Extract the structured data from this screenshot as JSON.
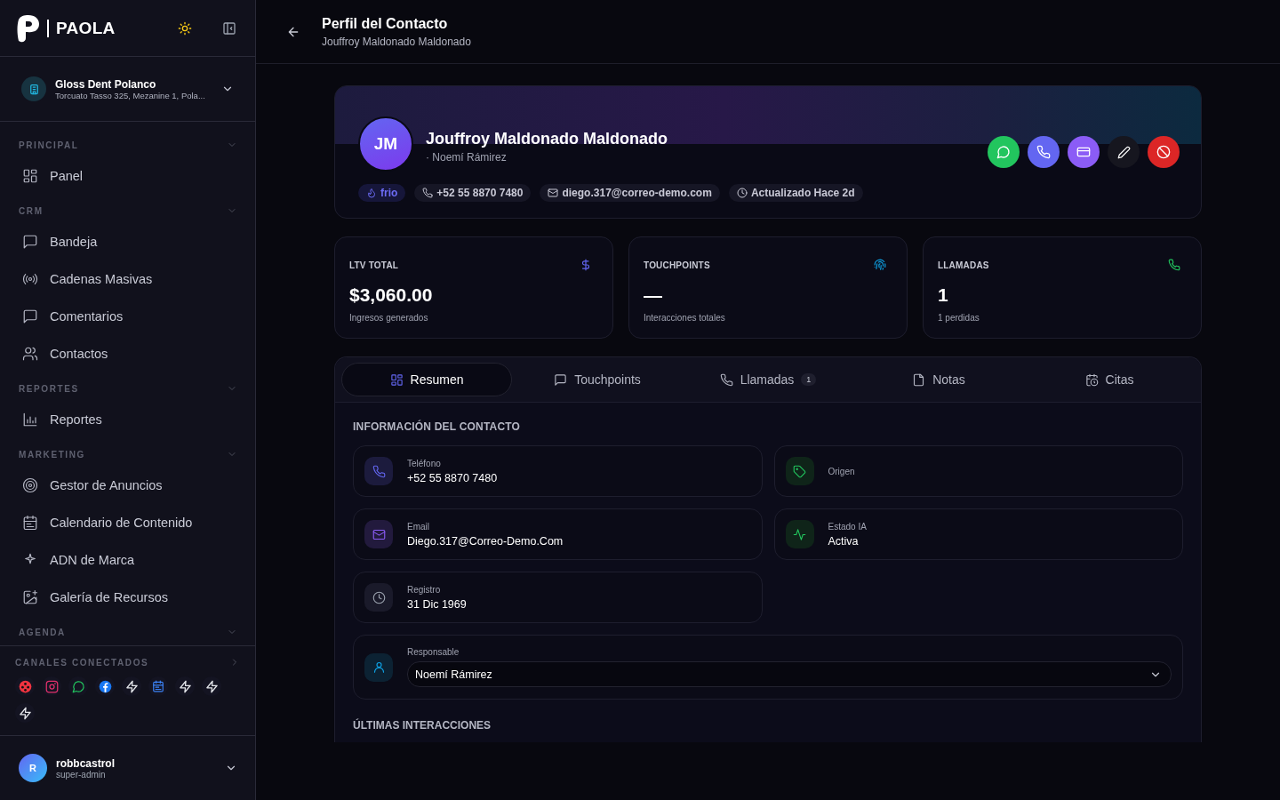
{
  "brand": {
    "name": "PAOLA"
  },
  "clinic": {
    "name": "Gloss Dent Polanco",
    "address": "Torcuato Tasso 325, Mezanine 1, Pola..."
  },
  "sidebar": {
    "sections": [
      {
        "title": "PRINCIPAL",
        "items": [
          {
            "label": "Panel"
          }
        ]
      },
      {
        "title": "CRM",
        "items": [
          {
            "label": "Bandeja"
          },
          {
            "label": "Cadenas Masivas"
          },
          {
            "label": "Comentarios"
          },
          {
            "label": "Contactos"
          }
        ]
      },
      {
        "title": "REPORTES",
        "items": [
          {
            "label": "Reportes"
          }
        ]
      },
      {
        "title": "MARKETING",
        "items": [
          {
            "label": "Gestor de Anuncios"
          },
          {
            "label": "Calendario de Contenido"
          },
          {
            "label": "ADN de Marca"
          },
          {
            "label": "Galería de Recursos"
          }
        ]
      },
      {
        "title": "AGENDA"
      }
    ]
  },
  "channels": {
    "title": "CANALES CONECTADOS"
  },
  "user": {
    "initial": "R",
    "name": "robbcastrol",
    "role": "super-admin"
  },
  "header": {
    "title": "Perfil del Contacto",
    "subtitle": "Jouffroy Maldonado Maldonado"
  },
  "contact": {
    "initials": "JM",
    "name": "Jouffroy Maldonado Maldonado",
    "owner": "· Noemí Rámirez",
    "chips": [
      {
        "kind": "temperature",
        "text": "frio"
      },
      {
        "kind": "phone",
        "text": "+52 55 8870 7480"
      },
      {
        "kind": "email",
        "text": "diego.317@correo-demo.com"
      },
      {
        "kind": "updated",
        "text": "Actualizado Hace 2d"
      }
    ]
  },
  "stats": [
    {
      "label": "LTV TOTAL",
      "value": "$3,060.00",
      "note": "Ingresos generados"
    },
    {
      "label": "TOUCHPOINTS",
      "value": "—",
      "note": "Interacciones totales"
    },
    {
      "label": "LLAMADAS",
      "value": "1",
      "note": "1 perdidas"
    }
  ],
  "tabs": [
    {
      "label": "Resumen",
      "selected": true
    },
    {
      "label": "Touchpoints",
      "selected": false
    },
    {
      "label": "Llamadas",
      "selected": false,
      "count": "1"
    },
    {
      "label": "Notas",
      "selected": false
    },
    {
      "label": "Citas",
      "selected": false
    }
  ],
  "info": {
    "title": "INFORMACIÓN DEL CONTACTO",
    "fields": [
      {
        "label": "Teléfono",
        "value": "+52 55 8870 7480"
      },
      {
        "label": "Origen"
      },
      {
        "label": "Email",
        "value": "Diego.317@Correo-Demo.Com"
      },
      {
        "label": "Estado IA",
        "value": "Activa"
      },
      {
        "label": "Registro",
        "value": "31 Dic 1969"
      }
    ],
    "owner": {
      "label": "Responsable",
      "value": "Noemí Rámirez"
    }
  },
  "recent": {
    "title": "ÚLTIMAS INTERACCIONES"
  }
}
